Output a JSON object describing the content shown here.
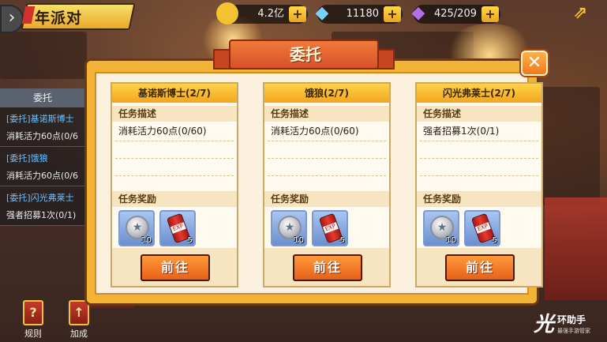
{
  "banner": {
    "title": "年派对"
  },
  "currencies": [
    {
      "icon": "gold-coin-icon",
      "glyph": "●",
      "value": "4.2亿",
      "color": "#f2c230"
    },
    {
      "icon": "blue-diamond-icon",
      "glyph": "◆",
      "value": "11180",
      "color": "#7ad0ff"
    },
    {
      "icon": "purple-crystal-icon",
      "glyph": "◆",
      "value": "425/209",
      "color": "#b070e8"
    }
  ],
  "plus": "+",
  "left_panel": {
    "header": "委托",
    "items": [
      {
        "title": "[委托]基诺斯博士",
        "sub": "消耗活力60点(0/6"
      },
      {
        "title": "[委托]饿狼",
        "sub": "消耗活力60点(0/6"
      },
      {
        "title": "[委托]闪光弗莱士",
        "sub": "强者招募1次(0/1)"
      }
    ]
  },
  "bottom_buttons": [
    {
      "label": "规则",
      "glyph": "?"
    },
    {
      "label": "加成",
      "glyph": "↑"
    }
  ],
  "dialog": {
    "title": "委托",
    "close_glyph": "✕",
    "cards": [
      {
        "name": "基诺斯博士(2/7)",
        "desc_label": "任务描述",
        "desc": "消耗活力60点(0/60)",
        "reward_label": "任务奖励",
        "rewards": [
          {
            "type": "coin",
            "qty": "10"
          },
          {
            "type": "can",
            "qty": "5"
          }
        ],
        "button": "前往"
      },
      {
        "name": "饿狼(2/7)",
        "desc_label": "任务描述",
        "desc": "消耗活力60点(0/60)",
        "reward_label": "任务奖励",
        "rewards": [
          {
            "type": "coin",
            "qty": "10"
          },
          {
            "type": "can",
            "qty": "5"
          }
        ],
        "button": "前往"
      },
      {
        "name": "闪光弗莱士(2/7)",
        "desc_label": "任务描述",
        "desc": "强者招募1次(0/1)",
        "reward_label": "任务奖励",
        "rewards": [
          {
            "type": "coin",
            "qty": "10"
          },
          {
            "type": "can",
            "qty": "5"
          }
        ],
        "button": "前往"
      }
    ]
  },
  "watermark": {
    "main": "光",
    "text": "环助手",
    "sub": "最强手游管家"
  }
}
